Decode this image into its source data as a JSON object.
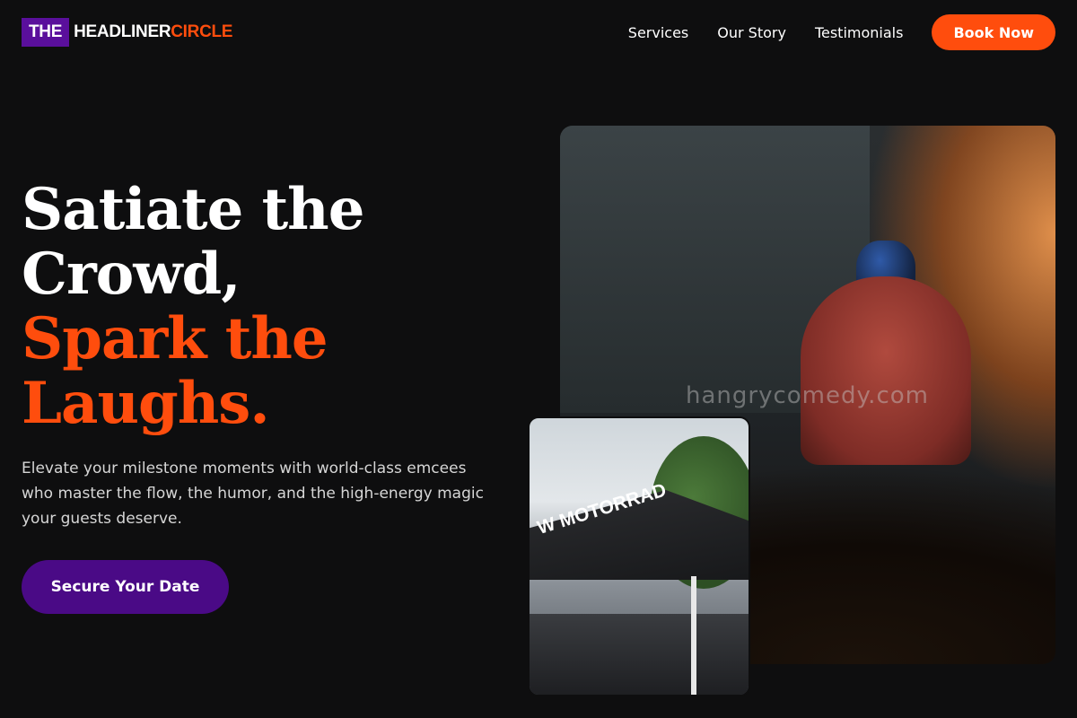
{
  "brand": {
    "part_the": "THE",
    "part_headliner": "HEADLINER",
    "part_circle": "CIRCLE"
  },
  "nav": {
    "links": [
      "Services",
      "Our Story",
      "Testimonials"
    ],
    "cta_label": "Book Now"
  },
  "hero": {
    "headline_lines": [
      "Satiate the",
      "Crowd,"
    ],
    "accent_lines": [
      "Spark the",
      "Laughs."
    ],
    "subtext": "Elevate your milestone moments with world-class emcees who master the flow, the humor, and the high-energy magic your guests deserve.",
    "cta_label": "Secure Your Date"
  },
  "images": {
    "main_watermark": "hangrycomedy.com",
    "secondary_banner_text": "W MOTORRAD"
  },
  "colors": {
    "accent_orange": "#ff4d0d",
    "brand_purple": "#5a0f9c",
    "cta_purple": "#4a0a86",
    "background": "#0e0e0f"
  }
}
